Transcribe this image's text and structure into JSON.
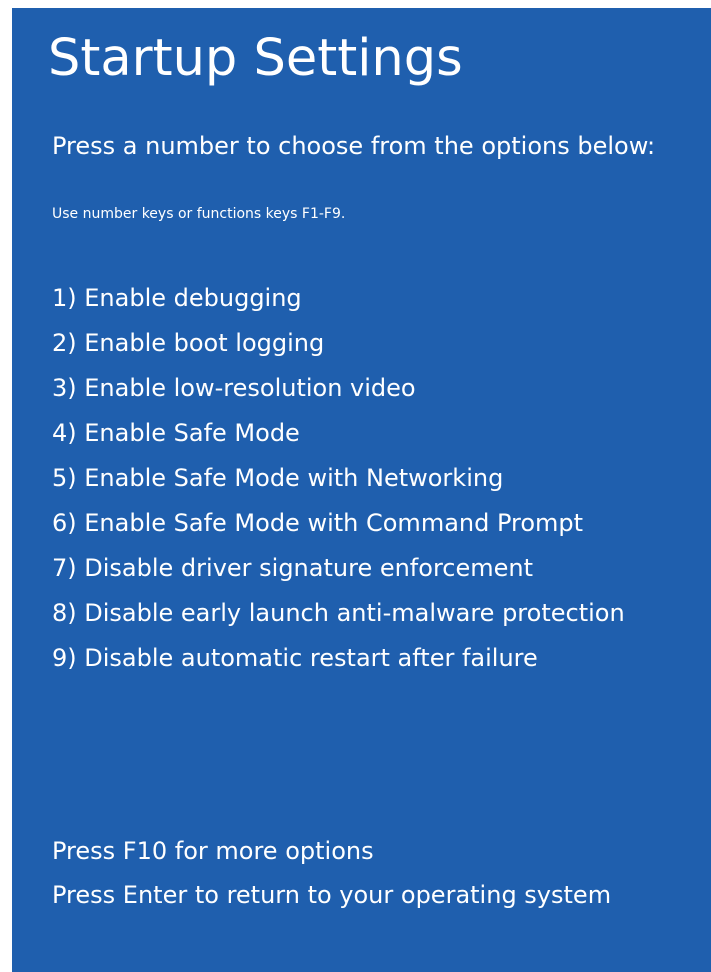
{
  "screen": {
    "title": "Startup Settings",
    "subtitle": "Press a number to choose from the options below:",
    "hint": "Use number keys or functions keys F1-F9.",
    "background_color": "#1f5fae",
    "text_color": "#ffffff"
  },
  "options": [
    "1) Enable debugging",
    "2) Enable boot logging",
    "3) Enable low-resolution video",
    "4) Enable Safe Mode",
    "5) Enable Safe Mode with Networking",
    "6) Enable Safe Mode with Command Prompt",
    "7) Disable driver signature enforcement",
    "8) Disable early launch anti-malware protection",
    "9) Disable automatic restart after failure"
  ],
  "footer": {
    "more_options": "Press F10 for more options",
    "return": "Press Enter to return to your operating system"
  }
}
